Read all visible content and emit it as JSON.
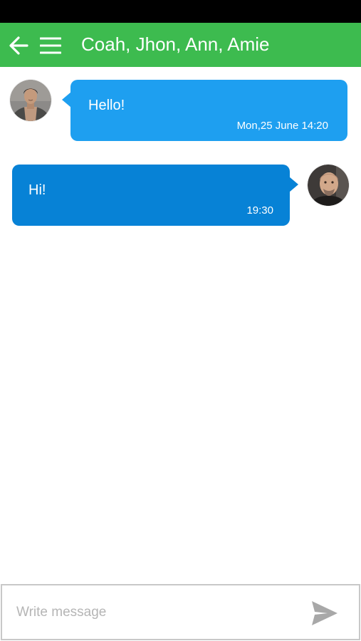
{
  "colors": {
    "status_bar": "#000000",
    "app_bar": "#3dbb4f",
    "incoming_bubble": "#1e9ff0",
    "outgoing_bubble": "#0782d6",
    "composer_border": "#c8c8c8",
    "send_icon": "#a8a8a8"
  },
  "header": {
    "back_icon": "arrow-left-icon",
    "menu_icon": "hamburger-menu-icon",
    "title": "Coah, Jhon, Ann, Amie"
  },
  "messages": [
    {
      "direction": "incoming",
      "text": "Hello!",
      "time": "Mon,25 June 14:20",
      "avatar": "avatar-young-man"
    },
    {
      "direction": "outgoing",
      "text": "Hi!",
      "time": "19:30",
      "avatar": "avatar-bald-man"
    }
  ],
  "composer": {
    "placeholder": "Write message",
    "value": "",
    "send_icon": "send-icon"
  }
}
